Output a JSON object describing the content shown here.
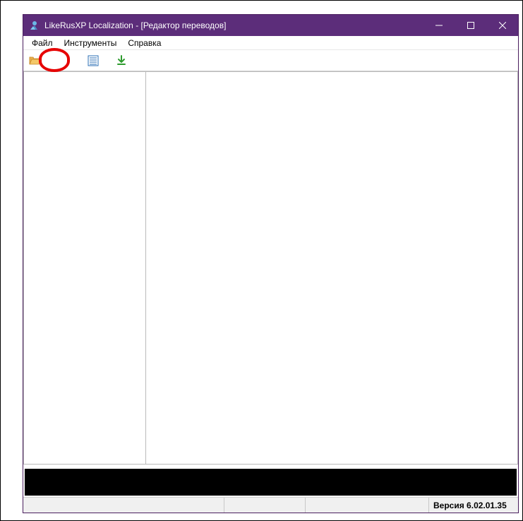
{
  "titlebar": {
    "title": "LikeRusXP Localization - [Редактор переводов]"
  },
  "menubar": {
    "file": "Файл",
    "tools": "Инструменты",
    "help": "Справка"
  },
  "toolbar": {
    "open_icon": "folder-open-icon",
    "list_icon": "list-icon",
    "download_icon": "download-icon"
  },
  "statusbar": {
    "version": "Версия 6.02.01.35"
  }
}
